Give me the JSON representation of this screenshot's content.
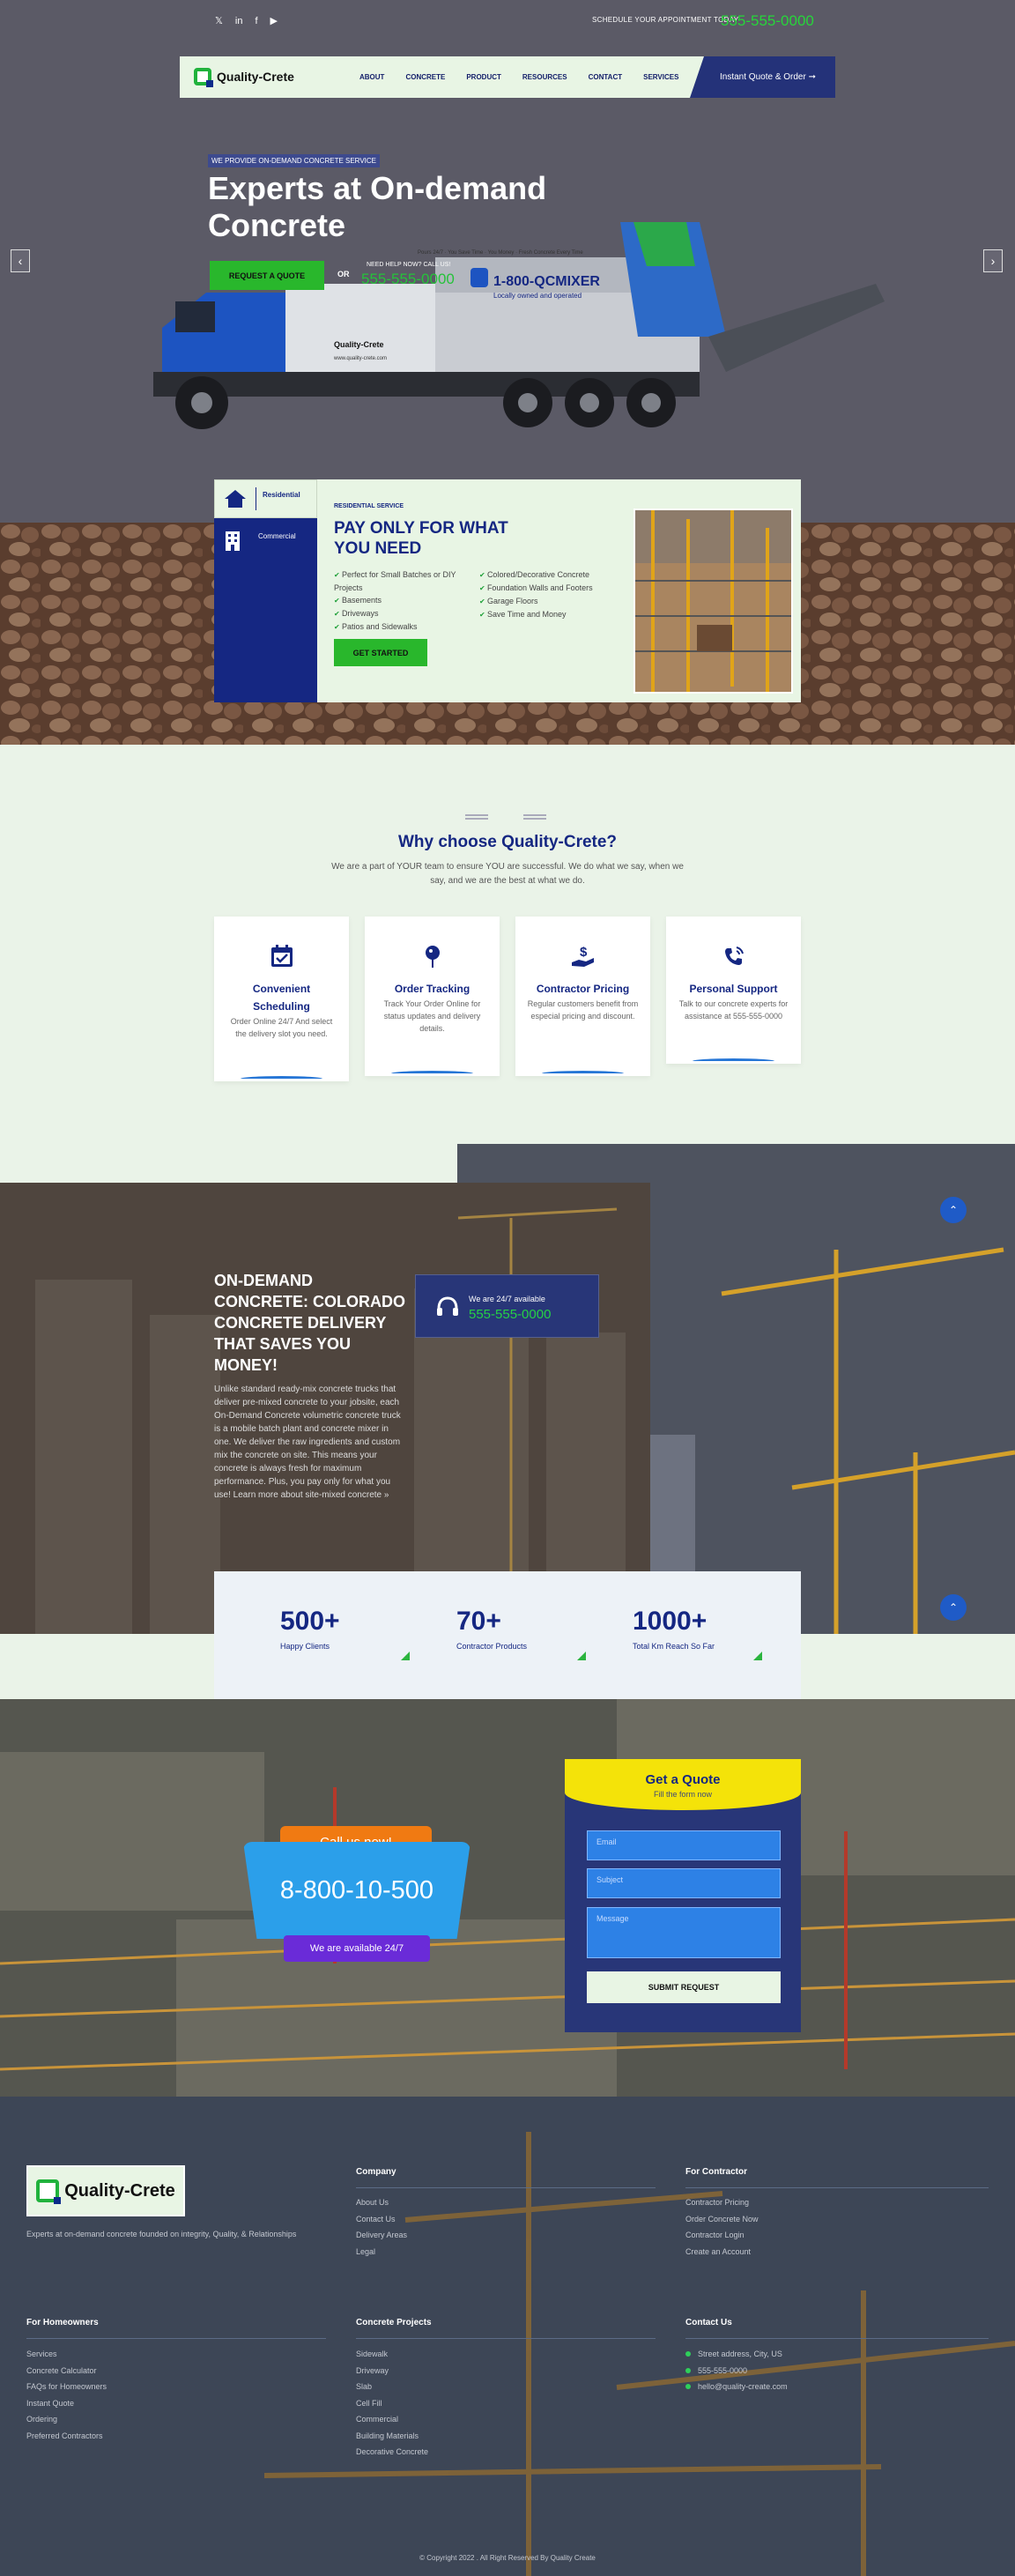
{
  "topbar": {
    "social_icons": [
      "twitter-icon",
      "linkedin-icon",
      "facebook-icon",
      "youtube-icon"
    ],
    "social_glyphs": [
      "𝕏",
      "in",
      "f",
      "▶"
    ],
    "schedule_label": "SCHEDULE YOUR APPOINTMENT TODAY",
    "phone": "555-555-0000"
  },
  "nav": {
    "logo_text": "Quality-Crete",
    "links": [
      "ABOUT",
      "CONCRETE",
      "PRODUCT",
      "RESOURCES",
      "CONTACT",
      "SERVICES"
    ],
    "cta": "Instant Quote & Order ➞"
  },
  "hero": {
    "tag": "WE PROVIDE ON-DEMAND CONCRETE SERVICE",
    "title": "Experts at On-demand Concrete",
    "button": "REQUEST A QUOTE",
    "or": "OR",
    "help_label": "NEED HELP NOW? CALL US!",
    "phone": "555-555-0000",
    "prev": "‹",
    "next": "›",
    "truck_text": {
      "tagline": "Pours 24/7 · You Save Time · You Money · Fresh Concrete Every Time",
      "number": "1-800-QCMIXER",
      "owned": "Locally owned and operated",
      "brand": "Quality-Crete",
      "url": "www.quality-crete.com"
    }
  },
  "service": {
    "tabs": [
      "Residential",
      "Commercial"
    ],
    "small_label": "RESIDENTIAL SERVICE",
    "title": "PAY ONLY FOR WHAT YOU NEED",
    "list_left": [
      "Perfect for Small Batches or DIY Projects",
      "Basements",
      "Driveways",
      "Patios and Sidewalks"
    ],
    "list_right": [
      "Colored/Decorative Concrete",
      "Foundation Walls and Footers",
      "Garage Floors",
      "Save Time and Money"
    ],
    "button": "GET STARTED"
  },
  "why": {
    "title": "Why choose Quality-Crete?",
    "subtitle": "We are a part of YOUR team to ensure YOU are successful. We do what we say, when we say, and we are the best at what we do.",
    "cards": [
      {
        "icon": "calendar-check-icon",
        "title": "Convenient Scheduling",
        "desc": "Order Online 24/7 And select the delivery slot you need."
      },
      {
        "icon": "map-pin-icon",
        "title": "Order Tracking",
        "desc": "Track Your Order Online for status updates and delivery details."
      },
      {
        "icon": "hand-dollar-icon",
        "title": "Contractor Pricing",
        "desc": "Regular customers benefit from especial pricing and discount."
      },
      {
        "icon": "phone-call-icon",
        "title": "Personal Support",
        "desc": "Talk to our concrete experts for assistance at 555-555-0000"
      }
    ]
  },
  "ondemand": {
    "title": "ON-DEMAND CONCRETE: COLORADO CONCRETE DELIVERY THAT SAVES YOU MONEY!",
    "text": "Unlike standard ready-mix concrete trucks that deliver pre-mixed concrete to your jobsite, each On-Demand Concrete volumetric concrete truck is a mobile batch plant and concrete mixer in one. We deliver the raw ingredients and custom mix the concrete on site. This means your concrete is always fresh for maximum performance. Plus, you pay only for what you use! Learn more about site-mixed concrete »",
    "avail_label": "We are 24/7 available",
    "phone": "555-555-0000",
    "up_arrow": "⌃"
  },
  "stats": [
    {
      "num": "500+",
      "label": "Happy Clients"
    },
    {
      "num": "70+",
      "label": "Contractor Products"
    },
    {
      "num": "1000+",
      "label": "Total Km Reach So Far"
    }
  ],
  "callnow": {
    "label": "Call us now!",
    "number": "8-800-10-500",
    "available": "We are available 24/7"
  },
  "quote_form": {
    "title": "Get a Quote",
    "subtitle": "Fill the form now",
    "email_placeholder": "Email",
    "subject_placeholder": "Subject",
    "message_placeholder": "Message",
    "submit": "SUBMIT REQUEST"
  },
  "footer": {
    "logo_text": "Quality-Crete",
    "desc": "Experts at on-demand concrete founded on integrity, Quality, & Relationships",
    "company": {
      "title": "Company",
      "items": [
        "About Us",
        "Contact Us",
        "Delivery Areas",
        "Legal"
      ]
    },
    "contractor": {
      "title": "For Contractor",
      "items": [
        "Contractor Pricing",
        "Order Concrete Now",
        "Contractor Login",
        "Create an Account"
      ]
    },
    "homeowners": {
      "title": "For Homeowners",
      "items": [
        "Services",
        "Concrete Calculator",
        "FAQs for Homeowners",
        "Instant Quote",
        "Ordering",
        "Preferred Contractors"
      ]
    },
    "projects": {
      "title": "Concrete Projects",
      "items": [
        "Sidewalk",
        "Driveway",
        "Slab",
        "Cell Fill",
        "Commercial",
        "Building Materials",
        "Decorative Concrete"
      ]
    },
    "contact": {
      "title": "Contact Us",
      "items": [
        "Street address, City, US",
        "555-555-0000",
        "hello@quality-create.com"
      ]
    },
    "copyright": "© Copyright 2022 . All Right Reserved By Quality Create"
  },
  "colors": {
    "brand_blue": "#152782",
    "brand_green": "#29b72c",
    "mint": "#e8f5e4",
    "accent_yellow": "#f4e309"
  }
}
